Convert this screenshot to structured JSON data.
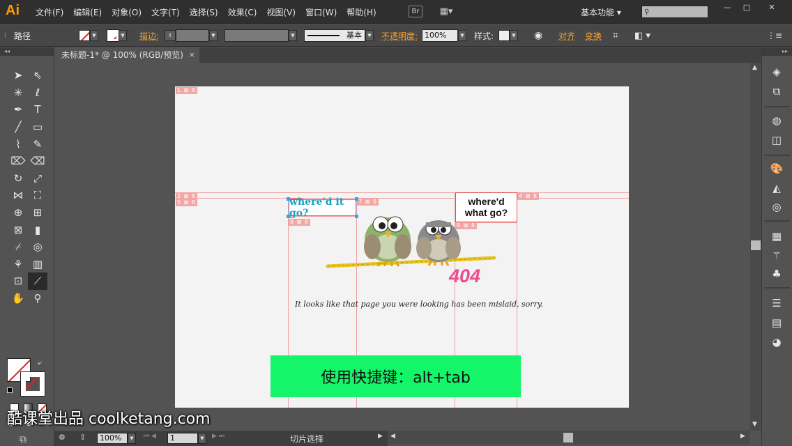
{
  "app": {
    "logo": "Ai"
  },
  "menu": [
    "文件(F)",
    "编辑(E)",
    "对象(O)",
    "文字(T)",
    "选择(S)",
    "效果(C)",
    "视图(V)",
    "窗口(W)",
    "帮助(H)"
  ],
  "menubar": {
    "bridge_label": "Br",
    "workspace_label": "基本功能",
    "window_buttons": [
      "—",
      "□",
      "✕"
    ]
  },
  "control_bar": {
    "object_type": "路径",
    "stroke_label": "描边:",
    "stroke_style_label": "基本",
    "opacity_label": "不透明度:",
    "opacity_value": "100%",
    "style_label": "样式:",
    "align_label": "对齐",
    "transform_label": "变换"
  },
  "document_tab": {
    "title": "未标题-1* @ 100% (RGB/预览)",
    "close": "×"
  },
  "artboard": {
    "slice_tags": [
      "1 ⊠ 8",
      "2 ⊠ 8",
      "5 ⊠ 8",
      "6 ⊠",
      "7 ⊠ 8",
      "3 ⊠",
      "4 ⊠ 8",
      "8 ⊠ 8",
      "9 ⊠ 8"
    ],
    "speech_bubble_left": "where'd it go?",
    "speech_bubble_right_line1": "where'd",
    "speech_bubble_right_line2": "what go?",
    "error_code": "404",
    "message": "It looks like that page you were looking has been mislaid, sorry.",
    "shortcut_banner": "使用快捷键：alt+tab"
  },
  "statusbar": {
    "zoom_value": "100%",
    "page_value": "1",
    "tool_name": "切片选择"
  },
  "watermark": "酷课堂出品 coolketang.com",
  "colors": {
    "accent_orange": "#f7a030",
    "banner_green": "#15f56a",
    "error_pink": "#ee4a90",
    "slice_guide": "#f0a0a0"
  }
}
